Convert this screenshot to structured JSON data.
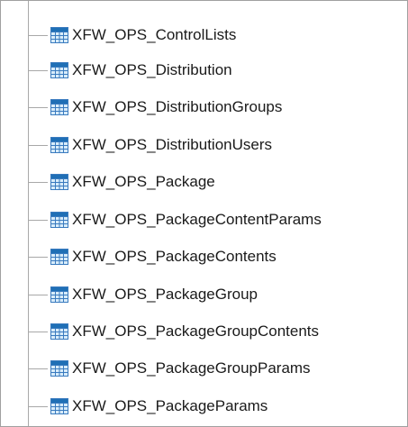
{
  "tree": {
    "items": [
      {
        "label": "XFW_OPS_ControlLists",
        "icon": "table-icon"
      },
      {
        "label": "XFW_OPS_Distribution",
        "icon": "table-icon"
      },
      {
        "label": "XFW_OPS_DistributionGroups",
        "icon": "table-icon"
      },
      {
        "label": "XFW_OPS_DistributionUsers",
        "icon": "table-icon"
      },
      {
        "label": "XFW_OPS_Package",
        "icon": "table-icon"
      },
      {
        "label": "XFW_OPS_PackageContentParams",
        "icon": "table-icon"
      },
      {
        "label": "XFW_OPS_PackageContents",
        "icon": "table-icon"
      },
      {
        "label": "XFW_OPS_PackageGroup",
        "icon": "table-icon"
      },
      {
        "label": "XFW_OPS_PackageGroupContents",
        "icon": "table-icon"
      },
      {
        "label": "XFW_OPS_PackageGroupParams",
        "icon": "table-icon"
      },
      {
        "label": "XFW_OPS_PackageParams",
        "icon": "table-icon"
      }
    ]
  },
  "colors": {
    "icon_header": "#1f6fb5",
    "icon_cell": "#d8ecfa",
    "icon_grid": "#3a7bbf",
    "tree_line": "#a8a8a8",
    "text": "#1a1a1a",
    "border": "#a0a0a0"
  }
}
